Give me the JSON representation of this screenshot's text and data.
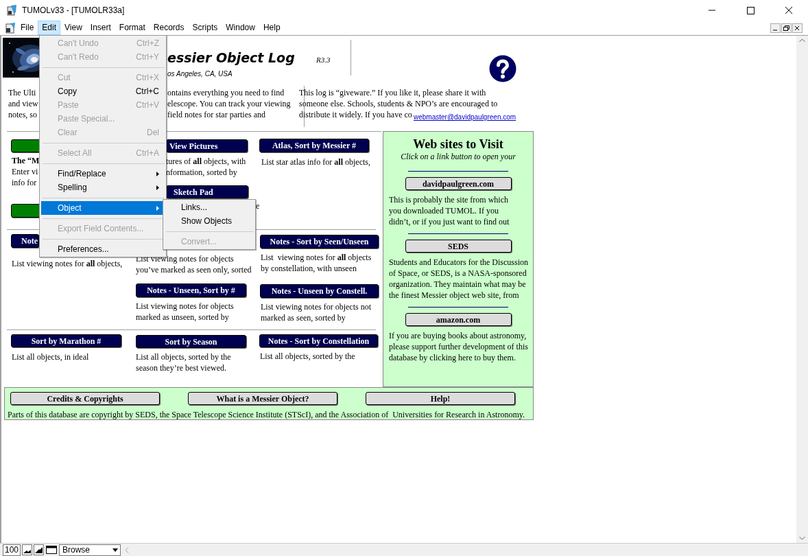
{
  "window": {
    "title": "TUMOLv33 - [TUMOLR33a]"
  },
  "menu_bar": [
    {
      "label": "File",
      "selected": false
    },
    {
      "label": "Edit",
      "selected": true
    },
    {
      "label": "View",
      "selected": false
    },
    {
      "label": "Insert",
      "selected": false
    },
    {
      "label": "Format",
      "selected": false
    },
    {
      "label": "Records",
      "selected": false
    },
    {
      "label": "Scripts",
      "selected": false
    },
    {
      "label": "Window",
      "selected": false
    },
    {
      "label": "Help",
      "selected": false
    }
  ],
  "edit_menu": [
    {
      "kind": "item",
      "label": "Can't Undo",
      "shortcut": "Ctrl+Z",
      "disabled": true,
      "selected": false
    },
    {
      "kind": "item",
      "label": "Can't Redo",
      "shortcut": "Ctrl+Y",
      "disabled": true,
      "selected": false
    },
    {
      "kind": "separator"
    },
    {
      "kind": "item",
      "label": "Cut",
      "shortcut": "Ctrl+X",
      "disabled": true,
      "selected": false
    },
    {
      "kind": "item",
      "label": "Copy",
      "shortcut": "Ctrl+C",
      "disabled": false,
      "selected": false
    },
    {
      "kind": "item",
      "label": "Paste",
      "shortcut": "Ctrl+V",
      "disabled": true,
      "selected": false
    },
    {
      "kind": "item",
      "label": "Paste Special...",
      "disabled": true,
      "selected": false
    },
    {
      "kind": "item",
      "label": "Clear",
      "shortcut": "Del",
      "disabled": true,
      "selected": false
    },
    {
      "kind": "separator"
    },
    {
      "kind": "item",
      "label": "Select All",
      "shortcut": "Ctrl+A",
      "disabled": true,
      "selected": false
    },
    {
      "kind": "separator"
    },
    {
      "kind": "submenu",
      "label": "Find/Replace",
      "disabled": false,
      "selected": false
    },
    {
      "kind": "submenu",
      "label": "Spelling",
      "disabled": false,
      "selected": false
    },
    {
      "kind": "separator"
    },
    {
      "kind": "submenu",
      "label": "Object",
      "disabled": false,
      "selected": true
    },
    {
      "kind": "separator"
    },
    {
      "kind": "item",
      "label": "Export Field Contents...",
      "disabled": true,
      "selected": false
    },
    {
      "kind": "separator"
    },
    {
      "kind": "item",
      "label": "Preferences...",
      "disabled": false,
      "selected": false
    }
  ],
  "object_submenu": [
    {
      "kind": "item",
      "label": "Links...",
      "disabled": false,
      "selected": false
    },
    {
      "kind": "item",
      "label": "Show Objects",
      "disabled": false,
      "selected": false
    },
    {
      "kind": "separator"
    },
    {
      "kind": "item",
      "label": "Convert...",
      "disabled": true,
      "selected": false
    }
  ],
  "layout_items": [
    {
      "kind": "picture"
    },
    {
      "kind": "title",
      "text": "essier Object Log"
    },
    {
      "kind": "version",
      "text": "R3.3"
    },
    {
      "kind": "location",
      "text": "os Angeles, CA, USA"
    },
    {
      "kind": "text",
      "lines": [
        "The Ulti",
        "and view",
        "notes, so"
      ]
    },
    {
      "kind": "text",
      "lines": [
        "ontains everything you need to find",
        "elescope. You can track your viewing",
        "field notes for star parties and"
      ]
    },
    {
      "kind": "text",
      "lines": [
        "This log is “giveware.” If you like it, please share it with",
        "someone else. Schools, students & NPO’s are encouraged to"
      ]
    },
    {
      "kind": "text",
      "lines": [
        "distribute it widely. If you have co"
      ]
    },
    {
      "kind": "link",
      "text": "webmaster@davidpaulgreen.com"
    },
    {
      "kind": "button",
      "color": "#008000"
    },
    {
      "kind": "button",
      "label": "View Pictures",
      "color": "#000050"
    },
    {
      "kind": "button",
      "label": "Atlas, Sort by Messier #",
      "color": "#000050"
    },
    {
      "kind": "text",
      "lines": [
        "**The “M**",
        "Enter vi",
        "info for"
      ]
    },
    {
      "kind": "text",
      "lines": [
        "tures of **all** objects, with",
        "nformation, sorted by"
      ]
    },
    {
      "kind": "text",
      "lines": [
        "List star atlas info for **all** objects,"
      ]
    },
    {
      "kind": "button",
      "label": "Sketch Pad",
      "color": "#000050"
    },
    {
      "kind": "button",
      "color": "#008000"
    },
    {
      "kind": "text",
      "lines": [
        "e"
      ]
    },
    {
      "kind": "button",
      "label": "Note",
      "color": "#000050"
    },
    {
      "kind": "button",
      "label": "Notes - Sort by Seen/Unseen",
      "color": "#000050"
    },
    {
      "kind": "text",
      "lines": [
        "List viewing notes for **all** objects,"
      ]
    },
    {
      "kind": "text",
      "lines": [
        "List viewing notes for objects",
        "you’ve marked as seen only, sorted"
      ]
    },
    {
      "kind": "text",
      "lines": [
        "List  viewing notes for **all** objects",
        "by constellation, with unseen"
      ]
    },
    {
      "kind": "button",
      "label": "Notes - Unseen, Sort by #",
      "color": "#000050"
    },
    {
      "kind": "button",
      "label": "Notes - Unseen by Constell.",
      "color": "#000050"
    },
    {
      "kind": "text",
      "lines": [
        "List viewing notes for objects",
        "marked as unseen, sorted by"
      ]
    },
    {
      "kind": "text",
      "lines": [
        "List viewing notes for objects not",
        "marked as seen, sorted by"
      ]
    },
    {
      "kind": "button",
      "label": "Sort by Marathon #",
      "color": "#000050"
    },
    {
      "kind": "button",
      "label": "Sort by Season",
      "color": "#000050"
    },
    {
      "kind": "button",
      "label": "Notes - Sort by Constellation",
      "color": "#000050"
    },
    {
      "kind": "text",
      "lines": [
        "List all objects, in ideal"
      ]
    },
    {
      "kind": "text",
      "lines": [
        "List all objects, sorted by the",
        "season they’re best viewed."
      ]
    },
    {
      "kind": "text",
      "lines": [
        "List all objects, sorted by the"
      ]
    }
  ],
  "side_panel": {
    "heading": "Web sites to Visit",
    "subheading": "Click on a link button to open your",
    "sites": [
      {
        "label": "davidpaulgreen.com",
        "lines": [
          "This is probably the site from which",
          "you downloaded TUMOL. If you",
          "didn’t, or if you just want to find out"
        ]
      },
      {
        "label": "SEDS",
        "lines": [
          "Students and Educators for the Discussion",
          "of Space, or SEDS, is a NASA-sponsored",
          "organization. They maintain what may be",
          "the finest Messier object web site, from"
        ]
      },
      {
        "label": "amazon.com",
        "lines": [
          "If you are buying books about astronomy,",
          "please support further development of this",
          "database by clicking here to buy them."
        ]
      }
    ]
  },
  "footer": {
    "buttons": [
      "Credits & Copyrights",
      "What is a Messier Object?",
      "Help!"
    ],
    "note": "Parts of this database are copyright by SEDS, the Space Telescope Science Institute (STScI), and the Association of  Universities for Research in Astronomy."
  },
  "status_bar": {
    "zoom": "100",
    "mode": "Browse"
  }
}
